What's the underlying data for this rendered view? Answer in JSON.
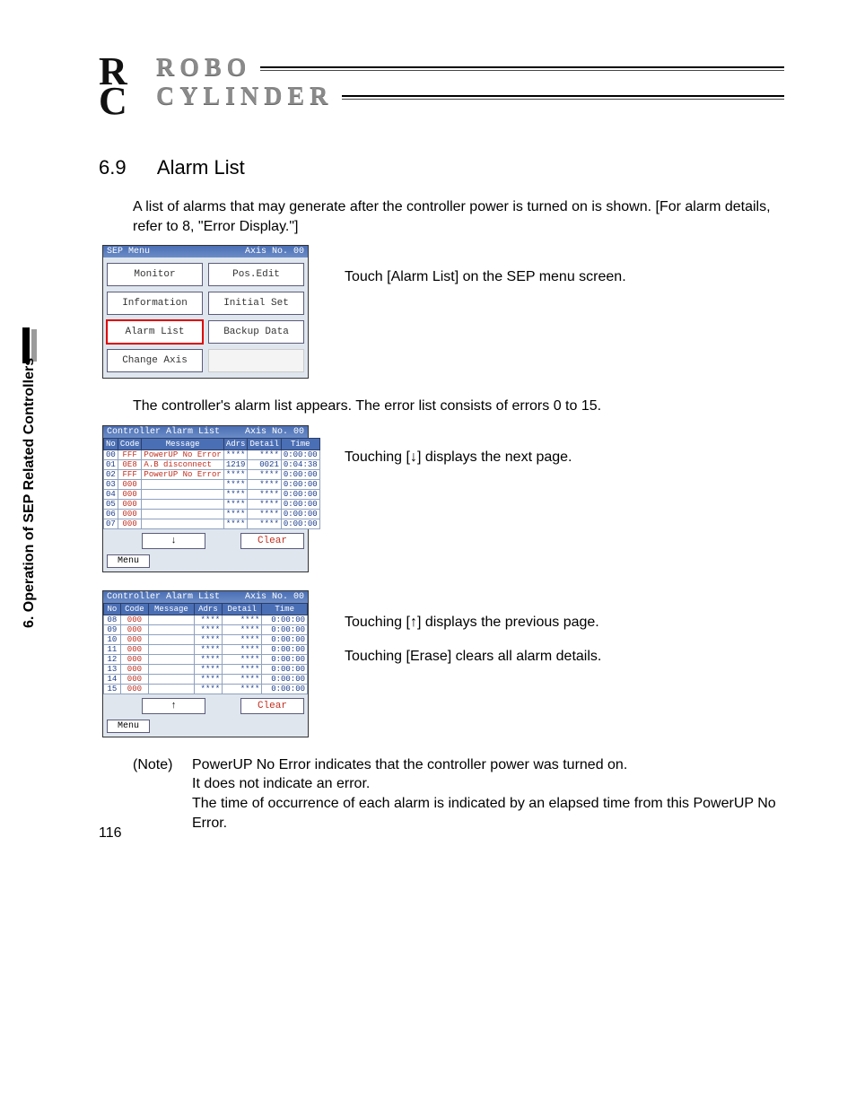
{
  "logo": {
    "line1": "ROBO",
    "line2": "CYLINDER"
  },
  "side_label": "6. Operation of SEP Related Controllers",
  "section": {
    "number": "6.9",
    "title": "Alarm List"
  },
  "intro": "A list of alarms that may generate after the controller power is turned on is shown. [For alarm details, refer to 8, \"Error Display.\"]",
  "step1_caption": "Touch [Alarm List] on the SEP menu screen.",
  "sep_menu": {
    "title_left": "SEP Menu",
    "title_right": "Axis No. 00",
    "buttons": [
      "Monitor",
      "Pos.Edit",
      "Information",
      "Initial Set",
      "Alarm List",
      "Backup Data",
      "Change Axis",
      ""
    ],
    "highlight_index": 4
  },
  "mid_text": "The controller's alarm list appears. The error list consists of errors 0 to 15.",
  "alarm_panel1": {
    "title_left": "Controller Alarm List",
    "title_right": "Axis No. 00",
    "headers": [
      "No",
      "Code",
      "Message",
      "Adrs",
      "Detail",
      "Time"
    ],
    "rows": [
      {
        "no": "00",
        "code": "FFF",
        "msg": "PowerUP No Error",
        "adrs": "****",
        "detail": "****",
        "time": "0:00:00"
      },
      {
        "no": "01",
        "code": "0E8",
        "msg": "A.B disconnect",
        "adrs": "1219",
        "detail": "0021",
        "time": "0:04:38"
      },
      {
        "no": "02",
        "code": "FFF",
        "msg": "PowerUP No Error",
        "adrs": "****",
        "detail": "****",
        "time": "0:00:00"
      },
      {
        "no": "03",
        "code": "000",
        "msg": "",
        "adrs": "****",
        "detail": "****",
        "time": "0:00:00"
      },
      {
        "no": "04",
        "code": "000",
        "msg": "",
        "adrs": "****",
        "detail": "****",
        "time": "0:00:00"
      },
      {
        "no": "05",
        "code": "000",
        "msg": "",
        "adrs": "****",
        "detail": "****",
        "time": "0:00:00"
      },
      {
        "no": "06",
        "code": "000",
        "msg": "",
        "adrs": "****",
        "detail": "****",
        "time": "0:00:00"
      },
      {
        "no": "07",
        "code": "000",
        "msg": "",
        "adrs": "****",
        "detail": "****",
        "time": "0:00:00"
      }
    ],
    "pager": "↓",
    "clear": "Clear",
    "menu": "Menu"
  },
  "step2_caption": "Touching [↓] displays the next page.",
  "alarm_panel2": {
    "title_left": "Controller Alarm List",
    "title_right": "Axis No. 00",
    "headers": [
      "No",
      "Code",
      "Message",
      "Adrs",
      "Detail",
      "Time"
    ],
    "rows": [
      {
        "no": "08",
        "code": "000",
        "msg": "",
        "adrs": "****",
        "detail": "****",
        "time": "0:00:00"
      },
      {
        "no": "09",
        "code": "000",
        "msg": "",
        "adrs": "****",
        "detail": "****",
        "time": "0:00:00"
      },
      {
        "no": "10",
        "code": "000",
        "msg": "",
        "adrs": "****",
        "detail": "****",
        "time": "0:00:00"
      },
      {
        "no": "11",
        "code": "000",
        "msg": "",
        "adrs": "****",
        "detail": "****",
        "time": "0:00:00"
      },
      {
        "no": "12",
        "code": "000",
        "msg": "",
        "adrs": "****",
        "detail": "****",
        "time": "0:00:00"
      },
      {
        "no": "13",
        "code": "000",
        "msg": "",
        "adrs": "****",
        "detail": "****",
        "time": "0:00:00"
      },
      {
        "no": "14",
        "code": "000",
        "msg": "",
        "adrs": "****",
        "detail": "****",
        "time": "0:00:00"
      },
      {
        "no": "15",
        "code": "000",
        "msg": "",
        "adrs": "****",
        "detail": "****",
        "time": "0:00:00"
      }
    ],
    "pager": "↑",
    "clear": "Clear",
    "menu": "Menu"
  },
  "step3_caption_a": "Touching [↑] displays the previous page.",
  "step3_caption_b": "Touching [Erase] clears all alarm details.",
  "note": {
    "label": "(Note)",
    "lines": [
      "PowerUP No Error indicates that the controller power was turned on.",
      "It does not indicate an error.",
      "The time of occurrence of each alarm is indicated by an elapsed time from this PowerUP No Error."
    ]
  },
  "page_number": "116"
}
